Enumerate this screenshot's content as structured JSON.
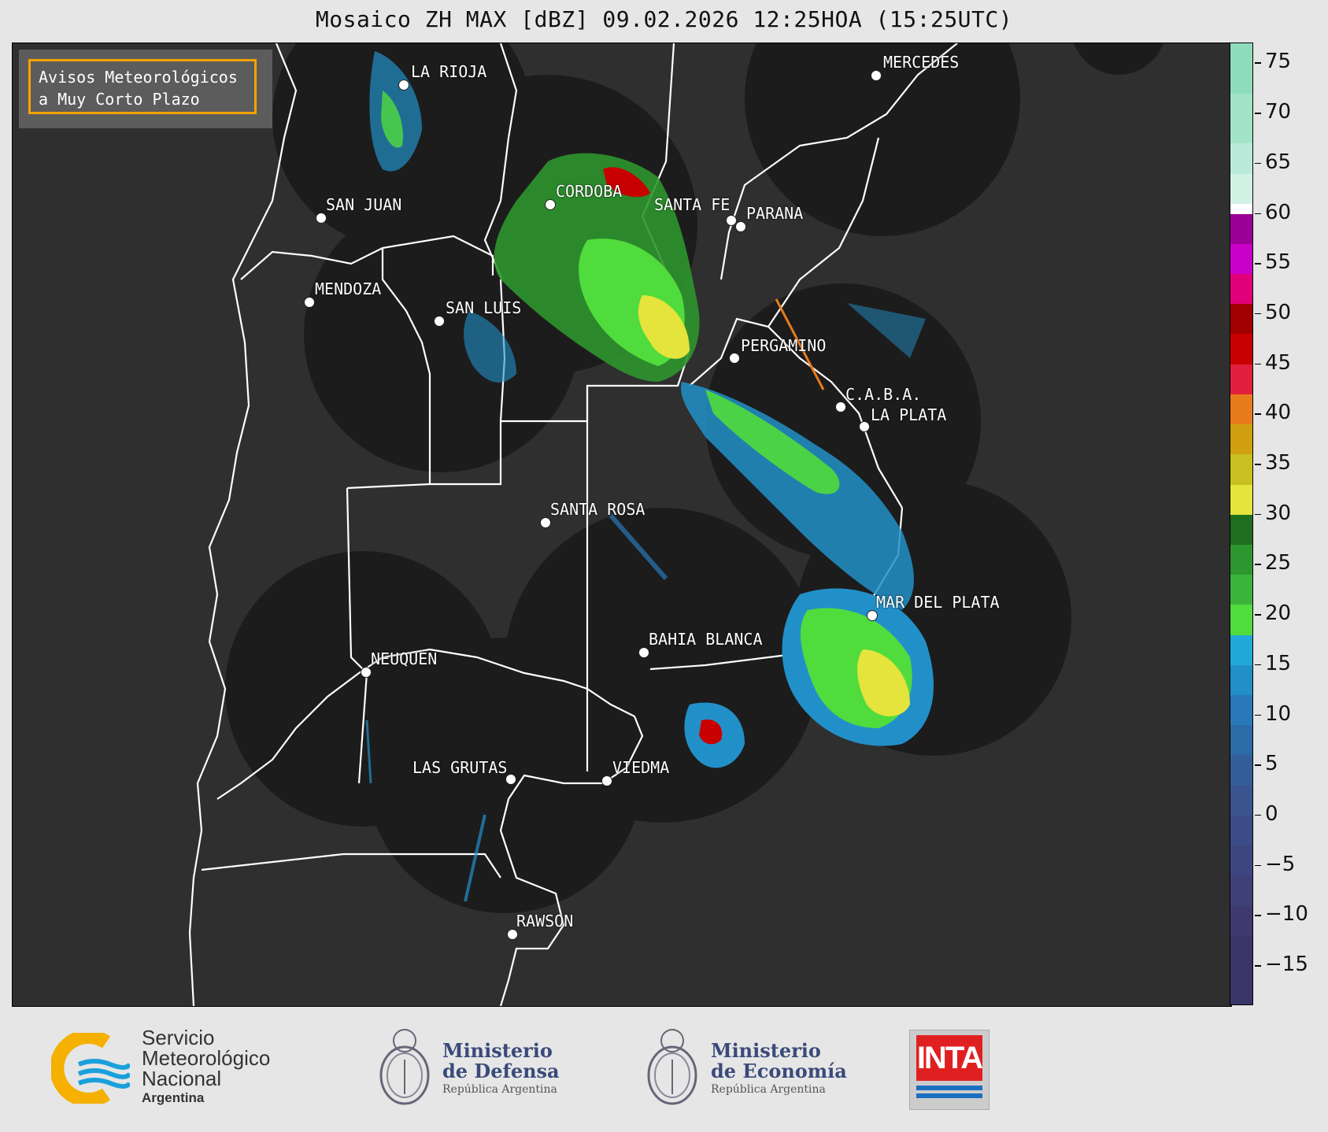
{
  "header": {
    "title": "Mosaico ZH MAX [dBZ] 09.02.2026 12:25HOA (15:25UTC)"
  },
  "notice": {
    "line1": "Avisos Meteorológicos",
    "line2": "a Muy Corto Plazo",
    "border_color": "#f5a300"
  },
  "cities": [
    {
      "name": "LA RIOJA"
    },
    {
      "name": "MERCEDES"
    },
    {
      "name": "CORDOBA"
    },
    {
      "name": "SAN JUAN"
    },
    {
      "name": "SANTA FE"
    },
    {
      "name": "PARANA"
    },
    {
      "name": "MENDOZA"
    },
    {
      "name": "SAN LUIS"
    },
    {
      "name": "PERGAMINO"
    },
    {
      "name": "C.A.B.A."
    },
    {
      "name": "LA PLATA"
    },
    {
      "name": "SANTA ROSA"
    },
    {
      "name": "MAR DEL PLATA"
    },
    {
      "name": "BAHIA BLANCA"
    },
    {
      "name": "NEUQUÉN"
    },
    {
      "name": "LAS GRUTAS"
    },
    {
      "name": "VIEDMA"
    },
    {
      "name": "RAWSON"
    }
  ],
  "colorbar": {
    "unit": "dBZ",
    "min": -19,
    "max": 77,
    "ticks": [
      "75",
      "70",
      "65",
      "60",
      "55",
      "50",
      "45",
      "40",
      "35",
      "30",
      "25",
      "20",
      "15",
      "10",
      "5",
      "0",
      "−5",
      "−10",
      "−15"
    ],
    "tick_values": [
      75,
      70,
      65,
      60,
      55,
      50,
      45,
      40,
      35,
      30,
      25,
      20,
      15,
      10,
      5,
      0,
      -5,
      -10,
      -15
    ],
    "segments": [
      {
        "from": 72,
        "to": 77,
        "color": "#8fdcbd"
      },
      {
        "from": 67,
        "to": 72,
        "color": "#a3e3c8"
      },
      {
        "from": 64,
        "to": 67,
        "color": "#bbeadb"
      },
      {
        "from": 61,
        "to": 64,
        "color": "#d3f2e6"
      },
      {
        "from": 60,
        "to": 61,
        "color": "#ffffff"
      },
      {
        "from": 57,
        "to": 60,
        "color": "#9a0096"
      },
      {
        "from": 54,
        "to": 57,
        "color": "#c800c8"
      },
      {
        "from": 51,
        "to": 54,
        "color": "#e0007a"
      },
      {
        "from": 48,
        "to": 51,
        "color": "#a00000"
      },
      {
        "from": 45,
        "to": 48,
        "color": "#c80000"
      },
      {
        "from": 42,
        "to": 45,
        "color": "#e0203c"
      },
      {
        "from": 39,
        "to": 42,
        "color": "#e87c1c"
      },
      {
        "from": 36,
        "to": 39,
        "color": "#d0a010"
      },
      {
        "from": 33,
        "to": 36,
        "color": "#c8c020"
      },
      {
        "from": 30,
        "to": 33,
        "color": "#e4e43c"
      },
      {
        "from": 27,
        "to": 30,
        "color": "#1e6e1e"
      },
      {
        "from": 24,
        "to": 27,
        "color": "#2e962e"
      },
      {
        "from": 21,
        "to": 24,
        "color": "#3cb43c"
      },
      {
        "from": 18,
        "to": 21,
        "color": "#50dc3c"
      },
      {
        "from": 15,
        "to": 18,
        "color": "#22a8d8"
      },
      {
        "from": 12,
        "to": 15,
        "color": "#2290c8"
      },
      {
        "from": 9,
        "to": 12,
        "color": "#2a78b8"
      },
      {
        "from": 6,
        "to": 9,
        "color": "#2c6aa8"
      },
      {
        "from": 3,
        "to": 6,
        "color": "#345e98"
      },
      {
        "from": 0,
        "to": 3,
        "color": "#3a5490"
      },
      {
        "from": -3,
        "to": 0,
        "color": "#3c4c88"
      },
      {
        "from": -6,
        "to": -3,
        "color": "#3e4680"
      },
      {
        "from": -9,
        "to": -6,
        "color": "#404078"
      },
      {
        "from": -12,
        "to": -9,
        "color": "#3e3a70"
      },
      {
        "from": -19,
        "to": -12,
        "color": "#3a3668"
      }
    ]
  },
  "footer": {
    "smn": {
      "line1": "Servicio",
      "line2": "Meteorológico",
      "line3": "Nacional",
      "country": "Argentina"
    },
    "defensa": {
      "line1": "Ministerio",
      "line2": "de Defensa",
      "sub": "República Argentina"
    },
    "economia": {
      "line1": "Ministerio",
      "line2": "de Economía",
      "sub": "República Argentina"
    },
    "inta": {
      "label": "INTA"
    }
  },
  "colors": {
    "map_background": "#2f2f2f",
    "radar_coverage": "#1c1c1c",
    "borders": "#ffffff"
  }
}
